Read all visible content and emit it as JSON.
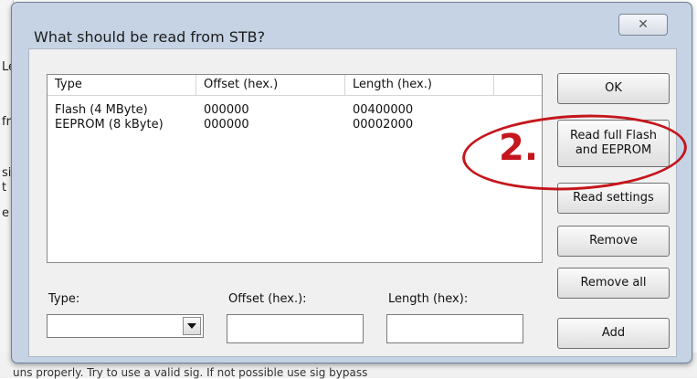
{
  "background": {
    "fragments": [
      "Le",
      "fr",
      "si",
      "t",
      "e"
    ],
    "bottom_text": "uns properly. Try to use a valid sig. If not possible use sig bypass"
  },
  "dialog": {
    "title": "What should be read from STB?",
    "close_symbol": "✕"
  },
  "list": {
    "columns": [
      "Type",
      "Offset (hex.)",
      "Length (hex.)"
    ],
    "rows": [
      {
        "type": "Flash (4 MByte)",
        "offset": "000000",
        "length": "00400000"
      },
      {
        "type": "EEPROM (8 kByte)",
        "offset": "000000",
        "length": "00002000"
      }
    ]
  },
  "fields": {
    "type_label": "Type:",
    "type_value": "",
    "offset_label": "Offset (hex.):",
    "offset_value": "",
    "length_label": "Length (hex):",
    "length_value": ""
  },
  "buttons": {
    "ok": "OK",
    "read_full_line1": "Read full Flash",
    "read_full_line2": "and EEPROM",
    "read_settings": "Read settings",
    "remove": "Remove",
    "remove_all": "Remove all",
    "add": "Add"
  },
  "annotation": {
    "number": "2.",
    "color": "#c4161c"
  }
}
